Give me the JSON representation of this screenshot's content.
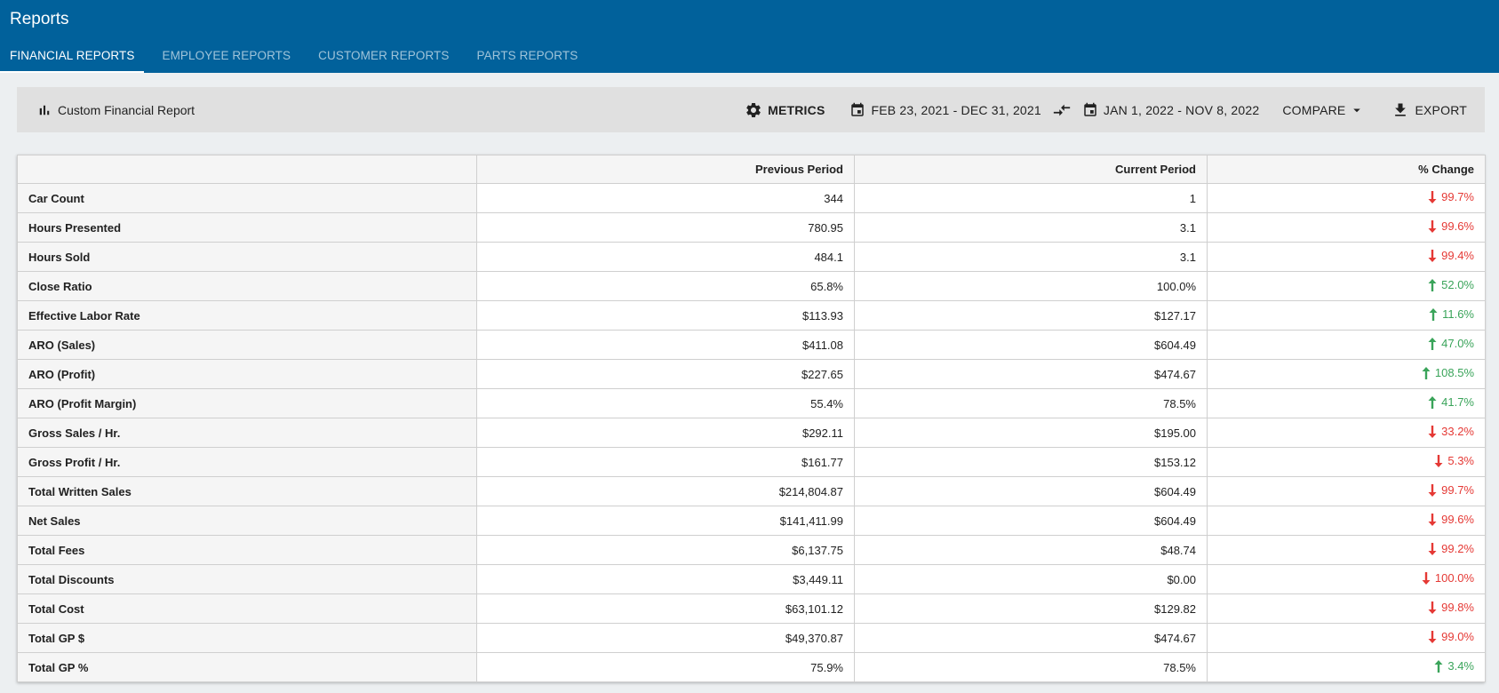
{
  "app": {
    "title": "Reports"
  },
  "tabs": [
    {
      "label": "FINANCIAL REPORTS",
      "active": true
    },
    {
      "label": "EMPLOYEE REPORTS",
      "active": false
    },
    {
      "label": "CUSTOMER REPORTS",
      "active": false
    },
    {
      "label": "PARTS REPORTS",
      "active": false
    }
  ],
  "toolbar": {
    "report_title": "Custom Financial Report",
    "metrics_label": "METRICS",
    "previous_range": "FEB 23, 2021 - DEC 31, 2021",
    "current_range": "JAN 1, 2022 - NOV 8, 2022",
    "compare_label": "COMPARE",
    "export_label": "EXPORT"
  },
  "colors": {
    "header": "#01619b",
    "up": "#3aa45a",
    "down": "#e53935"
  },
  "table": {
    "headers": [
      "",
      "Previous Period",
      "Current Period",
      "% Change"
    ],
    "rows": [
      {
        "metric": "Car Count",
        "previous": "344",
        "current": "1",
        "change": "99.7%",
        "dir": "down"
      },
      {
        "metric": "Hours Presented",
        "previous": "780.95",
        "current": "3.1",
        "change": "99.6%",
        "dir": "down"
      },
      {
        "metric": "Hours Sold",
        "previous": "484.1",
        "current": "3.1",
        "change": "99.4%",
        "dir": "down"
      },
      {
        "metric": "Close Ratio",
        "previous": "65.8%",
        "current": "100.0%",
        "change": "52.0%",
        "dir": "up"
      },
      {
        "metric": "Effective Labor Rate",
        "previous": "$113.93",
        "current": "$127.17",
        "change": "11.6%",
        "dir": "up"
      },
      {
        "metric": "ARO (Sales)",
        "previous": "$411.08",
        "current": "$604.49",
        "change": "47.0%",
        "dir": "up"
      },
      {
        "metric": "ARO (Profit)",
        "previous": "$227.65",
        "current": "$474.67",
        "change": "108.5%",
        "dir": "up"
      },
      {
        "metric": "ARO (Profit Margin)",
        "previous": "55.4%",
        "current": "78.5%",
        "change": "41.7%",
        "dir": "up"
      },
      {
        "metric": "Gross Sales / Hr.",
        "previous": "$292.11",
        "current": "$195.00",
        "change": "33.2%",
        "dir": "down"
      },
      {
        "metric": "Gross Profit / Hr.",
        "previous": "$161.77",
        "current": "$153.12",
        "change": "5.3%",
        "dir": "down"
      },
      {
        "metric": "Total Written Sales",
        "previous": "$214,804.87",
        "current": "$604.49",
        "change": "99.7%",
        "dir": "down"
      },
      {
        "metric": "Net Sales",
        "previous": "$141,411.99",
        "current": "$604.49",
        "change": "99.6%",
        "dir": "down"
      },
      {
        "metric": "Total Fees",
        "previous": "$6,137.75",
        "current": "$48.74",
        "change": "99.2%",
        "dir": "down"
      },
      {
        "metric": "Total Discounts",
        "previous": "$3,449.11",
        "current": "$0.00",
        "change": "100.0%",
        "dir": "down"
      },
      {
        "metric": "Total Cost",
        "previous": "$63,101.12",
        "current": "$129.82",
        "change": "99.8%",
        "dir": "down"
      },
      {
        "metric": "Total GP $",
        "previous": "$49,370.87",
        "current": "$474.67",
        "change": "99.0%",
        "dir": "down"
      },
      {
        "metric": "Total GP %",
        "previous": "75.9%",
        "current": "78.5%",
        "change": "3.4%",
        "dir": "up"
      }
    ]
  }
}
